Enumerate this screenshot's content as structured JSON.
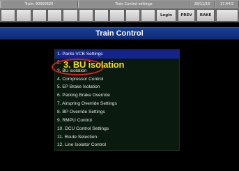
{
  "status_bar": {
    "train": "Train: 90000620",
    "title": "Train Control settings",
    "date": "28/11/19",
    "time": "17:44:5"
  },
  "softkeys": [
    "",
    "",
    "",
    "",
    "",
    "",
    "",
    "",
    "",
    "",
    "Login",
    "PREV",
    "RAKE",
    ""
  ],
  "page_title": "Train Control",
  "menu_items": [
    "1. Panto VCB Settings",
    "2.",
    "3. BU isolation",
    "4. Compressor Control",
    "5. EP Brake Isolation",
    "6. Parking Brake Override",
    "7. Airspring Override Settings",
    "8. BP Override Settings",
    "9. RMPU Control",
    "10. DCU Control Settings",
    "11. Route Selection",
    "12. Line Isolator Control"
  ],
  "selected_item": 0,
  "annotation": {
    "label": "3. BU isolation",
    "label_color": "#f4e100",
    "ellipse_color": "#e01c1c"
  }
}
